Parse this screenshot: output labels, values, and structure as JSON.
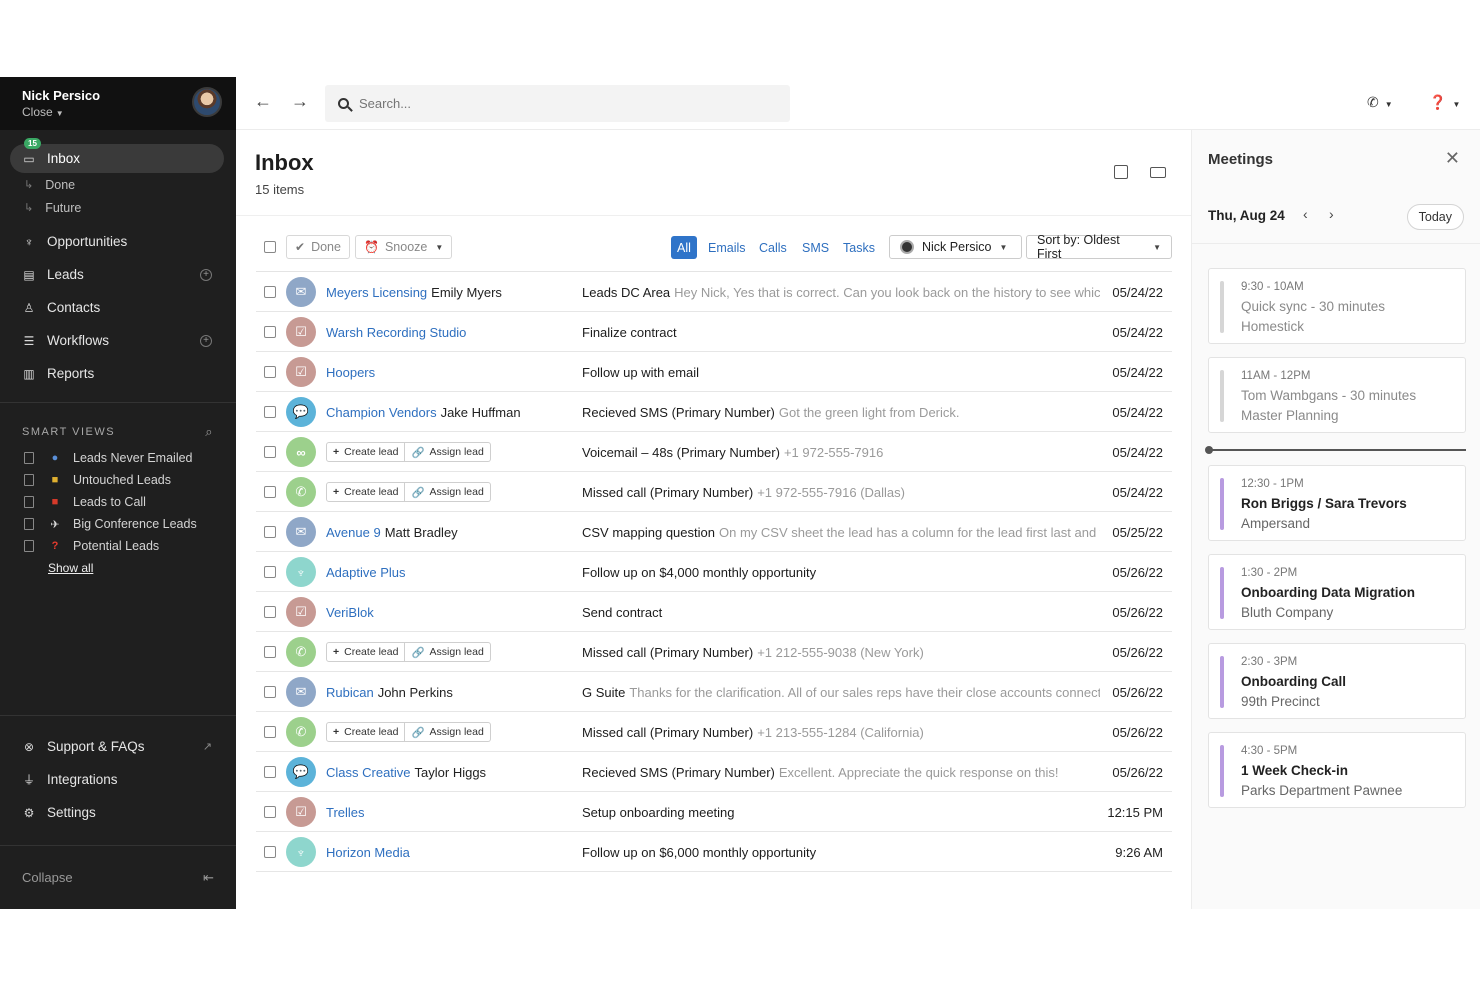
{
  "user": {
    "name": "Nick Persico",
    "org": "Close"
  },
  "sidebar": {
    "inbox": {
      "label": "Inbox",
      "badge": "15"
    },
    "sub_items": [
      {
        "label": "Done"
      },
      {
        "label": "Future"
      }
    ],
    "items": [
      {
        "label": "Opportunities"
      },
      {
        "label": "Leads"
      },
      {
        "label": "Contacts"
      },
      {
        "label": "Workflows"
      },
      {
        "label": "Reports"
      }
    ],
    "smart_views": {
      "heading": "SMART VIEWS",
      "items": [
        {
          "label": "Leads Never Emailed"
        },
        {
          "label": "Untouched Leads"
        },
        {
          "label": "Leads to Call"
        },
        {
          "label": "Big Conference Leads"
        },
        {
          "label": "Potential Leads"
        }
      ],
      "show_all": "Show all"
    },
    "bottom": [
      {
        "label": "Support & FAQs"
      },
      {
        "label": "Integrations"
      },
      {
        "label": "Settings"
      }
    ],
    "collapse": "Collapse"
  },
  "search": {
    "placeholder": "Search..."
  },
  "inbox": {
    "title": "Inbox",
    "count": "15 items",
    "toolbar": {
      "done": "Done",
      "snooze": "Snooze",
      "filters": [
        "All",
        "Emails",
        "Calls",
        "SMS",
        "Tasks"
      ],
      "owner": "Nick Persico",
      "sort": "Sort by: Oldest First"
    },
    "actions": {
      "create": "Create lead",
      "assign": "Assign lead"
    },
    "rows": [
      {
        "type": "email",
        "lead": "Meyers Licensing",
        "contact": "Emily Myers",
        "subject": "Leads DC Area",
        "snippet": "Hey Nick, Yes that is correct. Can you look back on the history to see which",
        "date": "05/24/22"
      },
      {
        "type": "task",
        "lead": "Warsh Recording Studio",
        "contact": "",
        "subject": "Finalize contract",
        "snippet": "",
        "date": "05/24/22"
      },
      {
        "type": "task",
        "lead": "Hoopers",
        "contact": "",
        "subject": "Follow up with email",
        "snippet": "",
        "date": "05/24/22"
      },
      {
        "type": "sms",
        "lead": "Champion Vendors",
        "contact": "Jake Huffman",
        "subject": "Recieved SMS (Primary Number)",
        "snippet": "Got the green light from Derick.",
        "date": "05/24/22"
      },
      {
        "type": "vm",
        "lead": "",
        "contact": "",
        "subject": "Voicemail – 48s (Primary Number)",
        "snippet": "+1 972-555-7916",
        "date": "05/24/22"
      },
      {
        "type": "call",
        "lead": "",
        "contact": "",
        "subject": "Missed call (Primary Number)",
        "snippet": "+1 972-555-7916 (Dallas)",
        "date": "05/24/22"
      },
      {
        "type": "email",
        "lead": "Avenue 9",
        "contact": "Matt Bradley",
        "subject": "CSV mapping question",
        "snippet": "On my CSV sheet the lead has a column for the lead first last and first",
        "date": "05/25/22"
      },
      {
        "type": "opp",
        "lead": "Adaptive Plus",
        "contact": "",
        "subject": "Follow up on $4,000 monthly opportunity",
        "snippet": "",
        "date": "05/26/22"
      },
      {
        "type": "task",
        "lead": "VeriBlok",
        "contact": "",
        "subject": "Send contract",
        "snippet": "",
        "date": "05/26/22"
      },
      {
        "type": "call",
        "lead": "",
        "contact": "",
        "subject": "Missed call (Primary Number)",
        "snippet": "+1 212-555-9038 (New York)",
        "date": "05/26/22"
      },
      {
        "type": "email",
        "lead": "Rubican",
        "contact": "John Perkins",
        "subject": "G Suite",
        "snippet": "Thanks for the clarification. All of our sales reps have their close accounts connected",
        "date": "05/26/22"
      },
      {
        "type": "call",
        "lead": "",
        "contact": "",
        "subject": "Missed call (Primary Number)",
        "snippet": "+1 213-555-1284 (California)",
        "date": "05/26/22"
      },
      {
        "type": "sms",
        "lead": "Class Creative",
        "contact": "Taylor Higgs",
        "subject": "Recieved SMS (Primary Number)",
        "snippet": "Excellent. Appreciate the quick response on this!",
        "date": "05/26/22"
      },
      {
        "type": "task",
        "lead": "Trelles",
        "contact": "",
        "subject": "Setup onboarding meeting",
        "snippet": "",
        "date": "12:15 PM"
      },
      {
        "type": "opp",
        "lead": "Horizon Media",
        "contact": "",
        "subject": "Follow up on $6,000 monthly opportunity",
        "snippet": "",
        "date": "9:26 AM"
      }
    ]
  },
  "meetings": {
    "title": "Meetings",
    "date": "Thu, Aug 24",
    "today": "Today",
    "items": [
      {
        "time": "9:30 - 10AM",
        "title": "Quick sync - 30 minutes",
        "company": "Homestick",
        "state": "past"
      },
      {
        "time": "11AM - 12PM",
        "title": "Tom Wambgans - 30 minutes",
        "company": "Master Planning",
        "state": "past"
      },
      {
        "time": "12:30 - 1PM",
        "title": "Ron Briggs / Sara Trevors",
        "company": "Ampersand",
        "state": "upcoming"
      },
      {
        "time": "1:30 - 2PM",
        "title": "Onboarding Data Migration",
        "company": "Bluth Company",
        "state": "upcoming"
      },
      {
        "time": "2:30 - 3PM",
        "title": "Onboarding Call",
        "company": "99th Precinct",
        "state": "upcoming"
      },
      {
        "time": "4:30 - 5PM",
        "title": "1 Week Check-in",
        "company": "Parks Department Pawnee",
        "state": "upcoming"
      }
    ]
  }
}
